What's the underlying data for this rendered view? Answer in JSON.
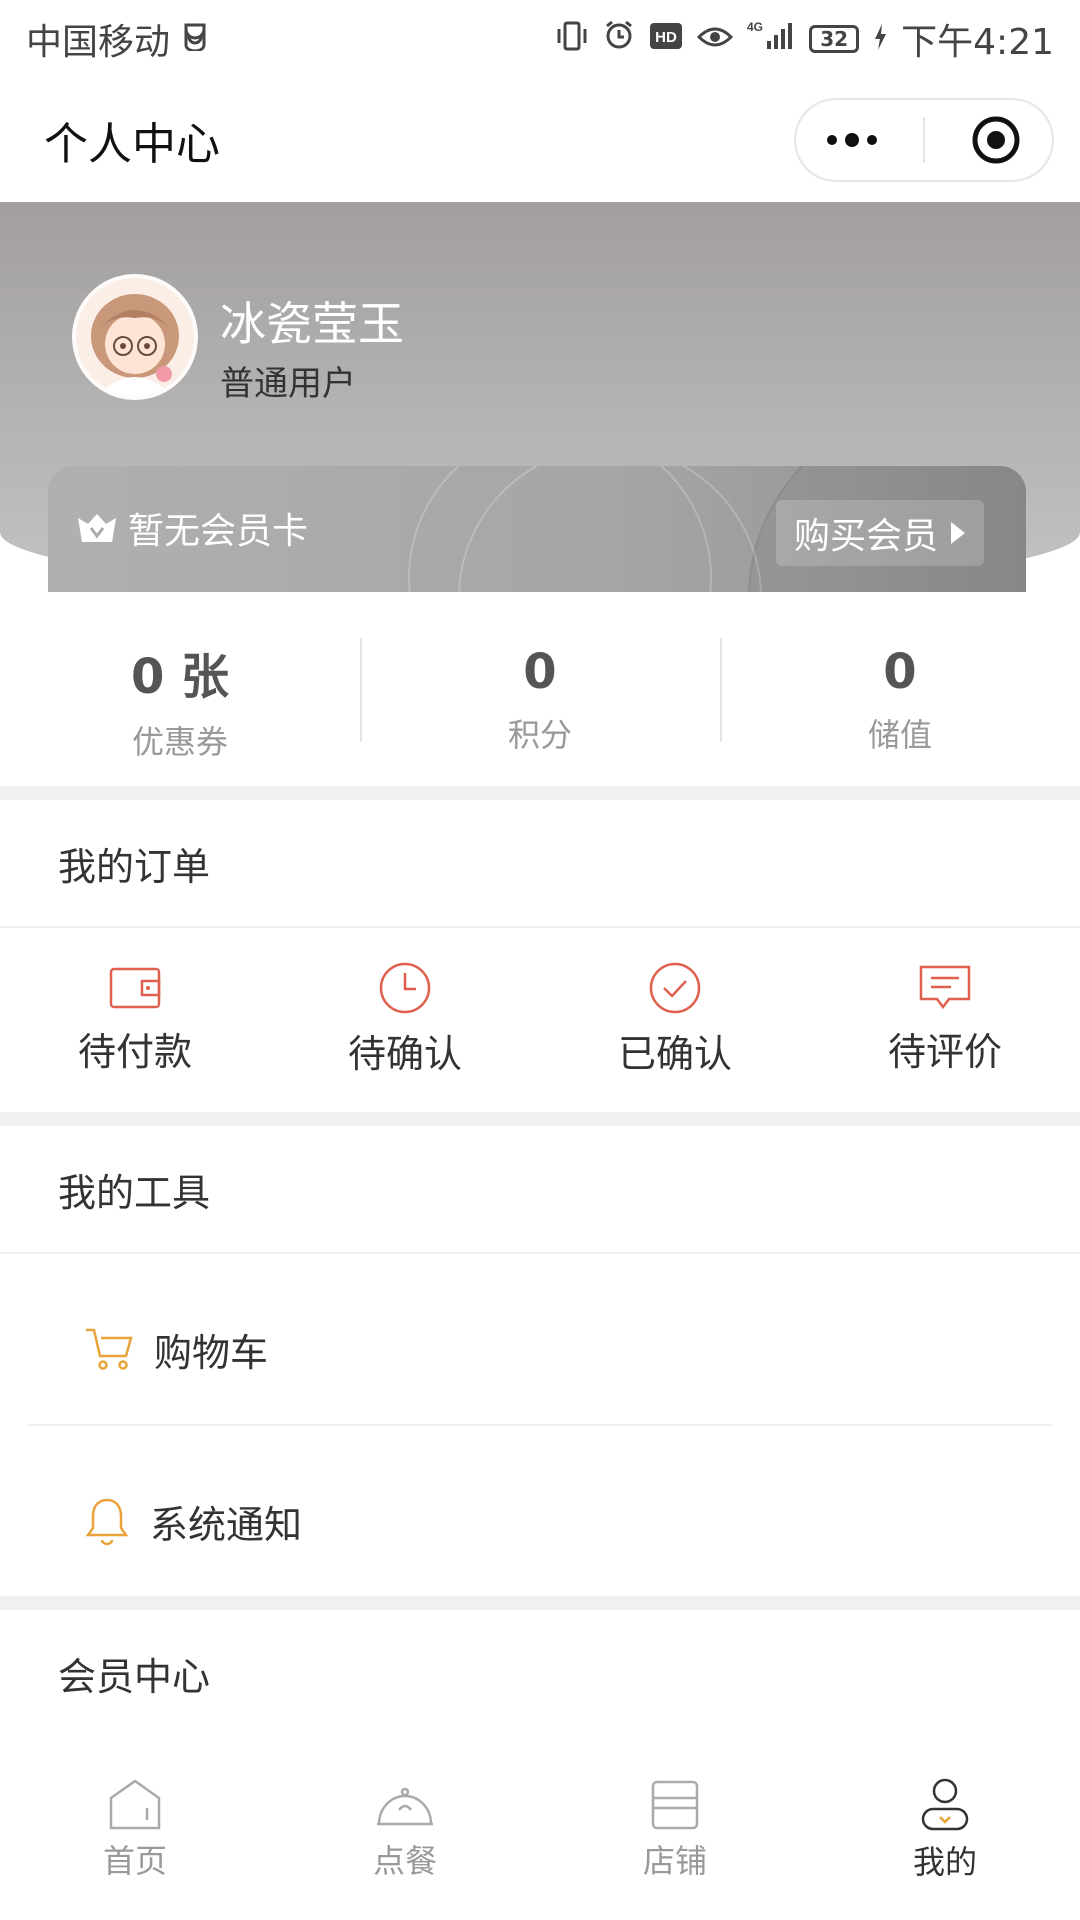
{
  "status_bar": {
    "carrier": "中国移动",
    "battery": "32",
    "time": "下午4:21"
  },
  "titlebar": {
    "title": "个人中心"
  },
  "profile": {
    "name": "冰瓷莹玉",
    "level": "普通用户",
    "vip_card_text": "暂无会员卡",
    "buy_button": "购买会员"
  },
  "stats": [
    {
      "value": "0 张",
      "label": "优惠券"
    },
    {
      "value": "0",
      "label": "积分"
    },
    {
      "value": "0",
      "label": "储值"
    }
  ],
  "orders": {
    "title": "我的订单",
    "items": [
      {
        "label": "待付款",
        "icon": "wallet-icon"
      },
      {
        "label": "待确认",
        "icon": "clock-icon"
      },
      {
        "label": "已确认",
        "icon": "check-circle-icon"
      },
      {
        "label": "待评价",
        "icon": "comment-icon"
      }
    ]
  },
  "tools": {
    "title": "我的工具",
    "items": [
      {
        "label": "购物车",
        "icon": "cart-icon"
      },
      {
        "label": "系统通知",
        "icon": "bell-icon"
      }
    ]
  },
  "member_center": {
    "title": "会员中心"
  },
  "tabbar": {
    "items": [
      {
        "label": "首页",
        "icon": "home-icon",
        "active": false
      },
      {
        "label": "点餐",
        "icon": "dish-icon",
        "active": false
      },
      {
        "label": "店铺",
        "icon": "store-icon",
        "active": false
      },
      {
        "label": "我的",
        "icon": "user-icon",
        "active": true
      }
    ]
  },
  "colors": {
    "accent_red": "#e0604f",
    "accent_orange": "#e8a33a"
  }
}
